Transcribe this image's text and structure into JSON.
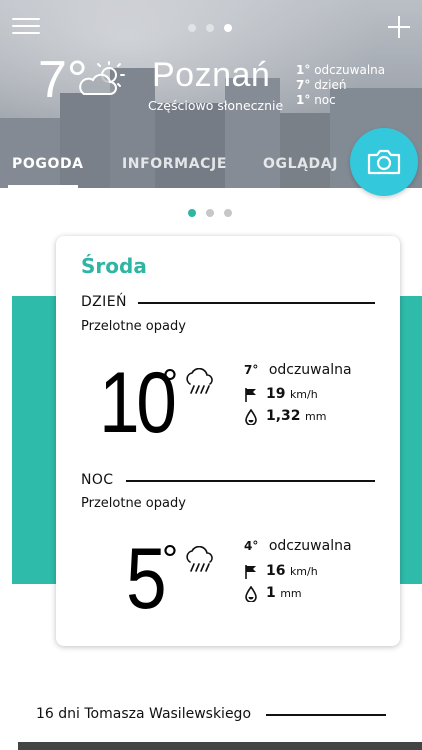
{
  "header": {
    "current_temp": "7°",
    "city": "Poznań",
    "condition": "Częściowo słonecznie",
    "stats": [
      {
        "value": "1°",
        "label": "odczuwalna"
      },
      {
        "value": "7°",
        "label": "dzień"
      },
      {
        "value": "1°",
        "label": "noc"
      }
    ],
    "page_count": 3,
    "active_page": 3
  },
  "tabs": [
    {
      "label": "POGODA",
      "active": true
    },
    {
      "label": "INFORMACJE",
      "active": false
    },
    {
      "label": "OGLĄDAJ",
      "active": false
    }
  ],
  "pager": {
    "count": 3,
    "active": 1
  },
  "card": {
    "day": "Środa",
    "day_part": {
      "heading": "DZIEŃ",
      "description": "Przelotne opady",
      "temp": "10",
      "deg": "°",
      "feels_value": "7°",
      "feels_label": "odczuwalna",
      "wind_value": "19",
      "wind_unit": "km/h",
      "rain_value": "1,32",
      "rain_unit": "mm"
    },
    "night_part": {
      "heading": "NOC",
      "description": "Przelotne opady",
      "temp": "5",
      "deg": "°",
      "feels_value": "4°",
      "feels_label": "odczuwalna",
      "wind_value": "16",
      "wind_unit": "km/h",
      "rain_value": "1",
      "rain_unit": "mm"
    }
  },
  "news": {
    "title": "16 dni Tomasza Wasilewskiego"
  },
  "colors": {
    "accent": "#2fbba9",
    "camera": "#34c8dc"
  },
  "icons": [
    "menu-icon",
    "plus-icon",
    "partly-sunny-icon",
    "camera-icon",
    "rain-cloud-icon",
    "wind-flag-icon",
    "rain-drop-icon"
  ]
}
